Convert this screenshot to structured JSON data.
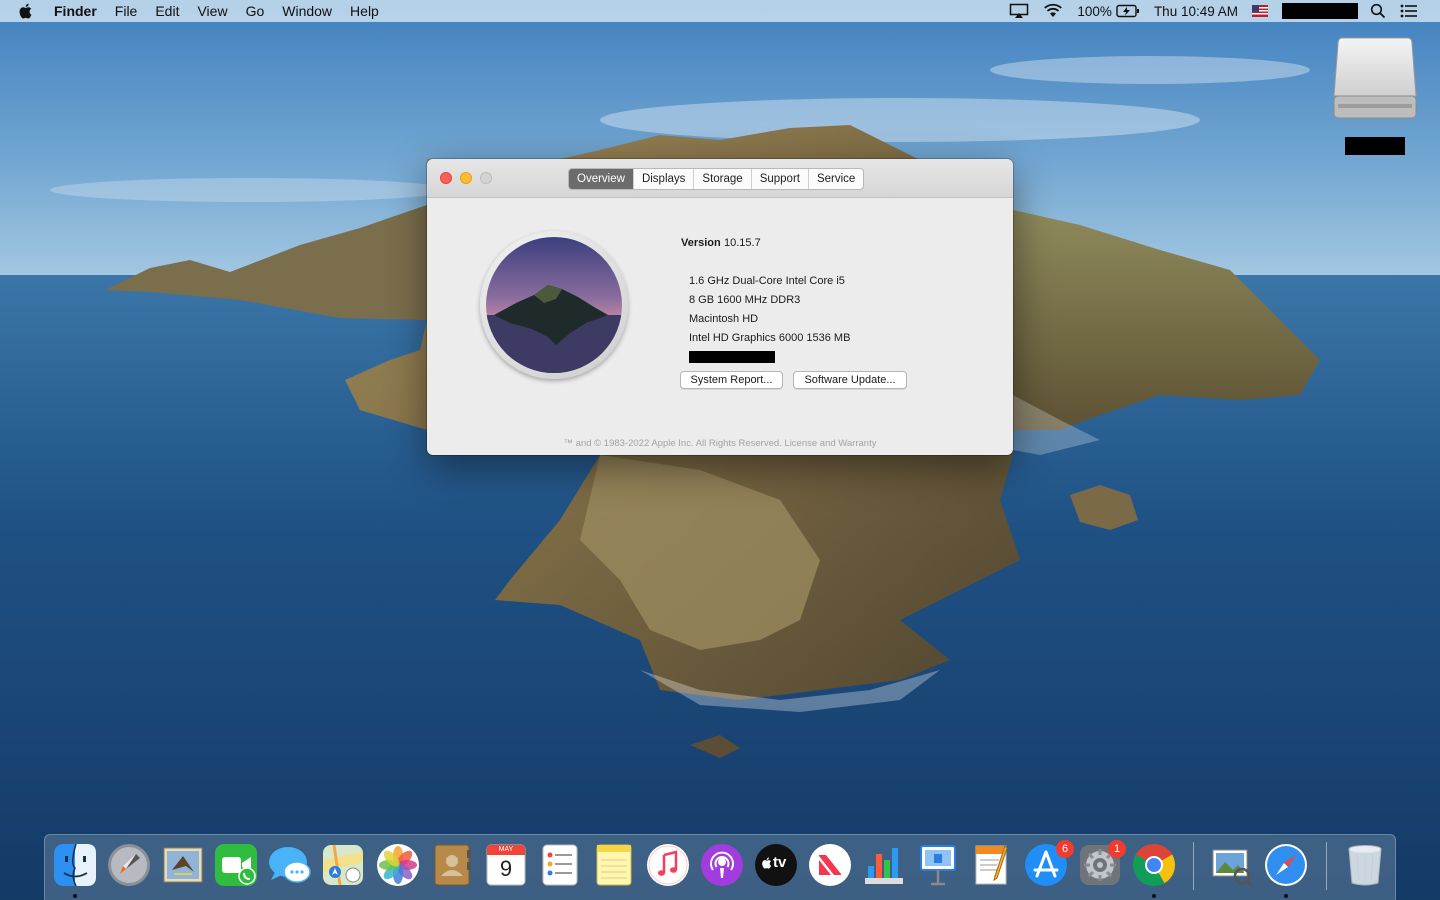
{
  "menubar": {
    "app_name": "Finder",
    "menus": [
      "File",
      "Edit",
      "View",
      "Go",
      "Window",
      "Help"
    ],
    "battery": "100%",
    "clock": "Thu 10:49 AM"
  },
  "about_window": {
    "tabs": [
      "Overview",
      "Displays",
      "Storage",
      "Support",
      "Service"
    ],
    "active_tab": "Overview",
    "version_label": "Version",
    "version_number": "10.15.7",
    "specs": [
      "1.6 GHz Dual-Core Intel Core i5",
      "8 GB 1600 MHz DDR3",
      "Macintosh HD",
      "Intel HD Graphics 6000 1536 MB"
    ],
    "buttons": {
      "system_report": "System Report...",
      "software_update": "Software Update..."
    },
    "copyright": "™ and © 1983-2022 Apple Inc. All Rights Reserved. License and Warranty"
  },
  "dock": {
    "apps": [
      {
        "name": "finder-icon",
        "running": true
      },
      {
        "name": "launchpad-icon",
        "running": false
      },
      {
        "name": "mail-icon",
        "running": false
      },
      {
        "name": "facetime-icon",
        "running": false
      },
      {
        "name": "messages-icon",
        "running": false
      },
      {
        "name": "maps-icon",
        "running": false
      },
      {
        "name": "photos-icon",
        "running": false
      },
      {
        "name": "contacts-icon",
        "running": false
      },
      {
        "name": "calendar-icon",
        "running": false
      },
      {
        "name": "reminders-icon",
        "running": false
      },
      {
        "name": "notes-icon",
        "running": false
      },
      {
        "name": "music-icon",
        "running": false
      },
      {
        "name": "podcasts-icon",
        "running": false
      },
      {
        "name": "tv-icon",
        "running": false
      },
      {
        "name": "news-icon",
        "running": false
      },
      {
        "name": "numbers-icon",
        "running": false
      },
      {
        "name": "keynote-icon",
        "running": false
      },
      {
        "name": "pages-icon",
        "running": false
      },
      {
        "name": "app-store-icon",
        "running": false
      },
      {
        "name": "system-preferences-icon",
        "running": true
      },
      {
        "name": "chrome-icon",
        "running": true
      }
    ],
    "calendar_month": "MAY",
    "calendar_day": "9",
    "tv_label": "tv",
    "app_store_badge": "6",
    "system_preferences_badge": "1",
    "colors": {
      "badge": "#f23b30",
      "dock_bg": "#5f7d9b"
    }
  }
}
